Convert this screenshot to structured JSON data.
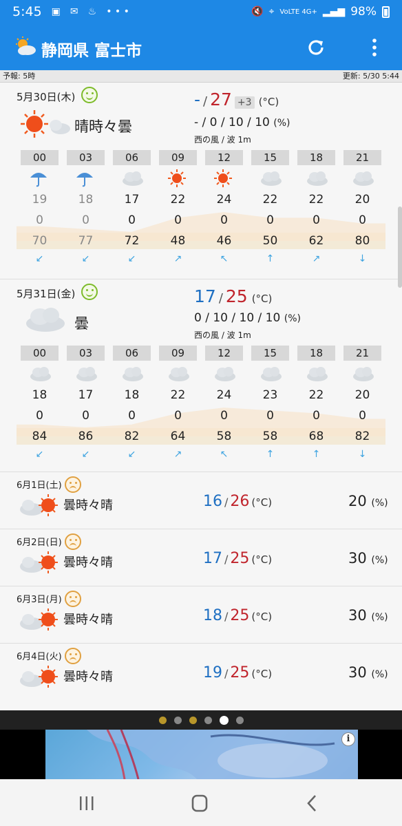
{
  "status": {
    "time": "5:45",
    "network": "VoLTE 4G+",
    "battery": "98%"
  },
  "app": {
    "title": "静岡県 富士市"
  },
  "info": {
    "forecast_time": "予報: 5時",
    "updated": "更新: 5/30 5:44"
  },
  "day1": {
    "date": "5月30日(木)",
    "weather": "晴時々曇",
    "temp_lo": "-",
    "temp_hi": "27",
    "temp_diff": "+3",
    "unit": "(°C)",
    "pop": "- / 0 / 10 / 10",
    "pop_unit": "(%)",
    "wind": "西の風 / 波 1m",
    "hours": [
      "00",
      "03",
      "06",
      "09",
      "12",
      "15",
      "18",
      "21"
    ],
    "icons": [
      "umbrella",
      "umbrella",
      "cloud",
      "sun",
      "sun",
      "cloud",
      "cloud",
      "cloud"
    ],
    "temps": [
      "19",
      "18",
      "17",
      "22",
      "24",
      "22",
      "22",
      "20"
    ],
    "rain": [
      "0",
      "0",
      "0",
      "0",
      "0",
      "0",
      "0",
      "0"
    ],
    "humidity": [
      "70",
      "77",
      "72",
      "48",
      "46",
      "50",
      "62",
      "80"
    ],
    "winds": [
      "↙",
      "↙",
      "↙",
      "↗",
      "↖",
      "↑",
      "↗",
      "↓"
    ]
  },
  "day2": {
    "date": "5月31日(金)",
    "weather": "曇",
    "temp_lo": "17",
    "temp_hi": "25",
    "unit": "(°C)",
    "pop": "0 / 10 / 10 / 10",
    "pop_unit": "(%)",
    "wind": "西の風 / 波 1m",
    "hours": [
      "00",
      "03",
      "06",
      "09",
      "12",
      "15",
      "18",
      "21"
    ],
    "icons": [
      "cloud",
      "cloud",
      "cloud",
      "cloud",
      "cloud",
      "cloud",
      "cloud",
      "cloud"
    ],
    "temps": [
      "18",
      "17",
      "18",
      "22",
      "24",
      "23",
      "22",
      "20"
    ],
    "rain": [
      "0",
      "0",
      "0",
      "0",
      "0",
      "0",
      "0",
      "0"
    ],
    "humidity": [
      "84",
      "86",
      "82",
      "64",
      "58",
      "58",
      "68",
      "82"
    ],
    "winds": [
      "↙",
      "↙",
      "↙",
      "↗",
      "↖",
      "↑",
      "↑",
      "↓"
    ]
  },
  "week": [
    {
      "date": "6月1日(土)",
      "weather": "曇時々晴",
      "lo": "16",
      "hi": "26",
      "unit": "(°C)",
      "pop": "20",
      "pop_unit": "(%)"
    },
    {
      "date": "6月2日(日)",
      "weather": "曇時々晴",
      "lo": "17",
      "hi": "25",
      "unit": "(°C)",
      "pop": "30",
      "pop_unit": "(%)"
    },
    {
      "date": "6月3日(月)",
      "weather": "曇時々晴",
      "lo": "18",
      "hi": "25",
      "unit": "(°C)",
      "pop": "30",
      "pop_unit": "(%)"
    },
    {
      "date": "6月4日(火)",
      "weather": "曇時々晴",
      "lo": "19",
      "hi": "25",
      "unit": "(°C)",
      "pop": "30",
      "pop_unit": "(%)"
    }
  ],
  "pager": {
    "dots": 6,
    "active_index": 4
  },
  "ad": {
    "info": "i"
  },
  "colors": {
    "primary": "#1e88e5",
    "hi_temp": "#c0242c",
    "lo_temp": "#1e6fc2",
    "wind_arrow": "#3da3e0"
  }
}
